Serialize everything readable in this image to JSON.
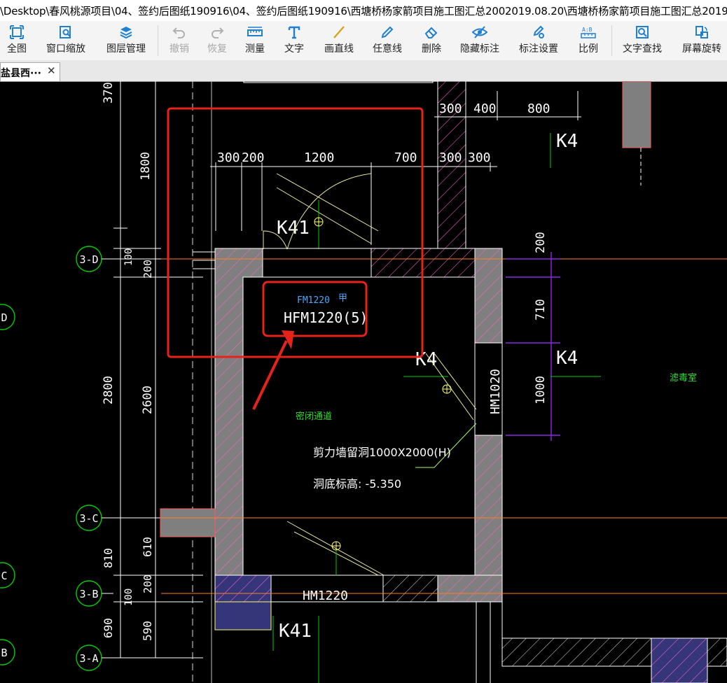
{
  "window": {
    "title": "\\Desktop\\春风桃源项目\\04、签约后图纸190916\\04、签约后图纸190916\\西塘桥杨家箭项目施工图汇总2002019.08.20\\西塘桥杨家箭项目施工图汇总2019"
  },
  "toolbar": {
    "full_view": "全图",
    "window_zoom": "窗口缩放",
    "layer_manager": "图层管理",
    "undo": "撤销",
    "redo": "恢复",
    "measure": "测量",
    "text": "文字",
    "draw_line": "画直线",
    "free_line": "任意线",
    "delete": "删除",
    "hide_annotation": "隐藏标注",
    "annotation_settings": "标注设置",
    "scale": "比例",
    "text_search": "文字查找",
    "screen_rotate": "屏幕旋转"
  },
  "tab": {
    "label": "盐县西···",
    "close": "✕"
  },
  "drawing": {
    "dims_left_outer": [
      "370",
      "1800",
      "100",
      "2800",
      "810",
      "100",
      "690"
    ],
    "dims_left_inner": [
      "200",
      "2600",
      "610",
      "200",
      "590"
    ],
    "dims_top_a": [
      "300",
      "200",
      "1200",
      "700"
    ],
    "dims_top_b": [
      "300",
      "300"
    ],
    "dims_top_c": [
      "300",
      "400",
      "800"
    ],
    "dims_right": [
      "200",
      "710",
      "1000"
    ],
    "axis_labels": [
      "3-D",
      "D",
      "3-C",
      "C",
      "3-B",
      "3-A",
      "B"
    ],
    "labels": {
      "k41_top": "K41",
      "k41_bottom": "K41",
      "k4_top": "K4",
      "k4_mid": "K4",
      "k4_right": "K4",
      "door_fm": "FM1220",
      "door_fm_grade": "甲",
      "door_hfm": "HFM1220(5)",
      "door_hm1020": "HM1020",
      "door_hm1220": "HM1220",
      "room_left": "密闭通道",
      "room_right": "滤毒室",
      "note_line1": "剪力墙留洞1000X2000(H)",
      "note_line2": "洞底标高: -5.350"
    }
  },
  "colors": {
    "background": "#000000",
    "highlight": "#e5231b",
    "wall_fill": "#808080",
    "hatch": "#ff64c8",
    "dim_line": "#ffffff",
    "axis_circle": "#00cc00",
    "door_blue": "#4aa8ff",
    "room_green": "#33dd33",
    "purple": "#8a2be2"
  }
}
